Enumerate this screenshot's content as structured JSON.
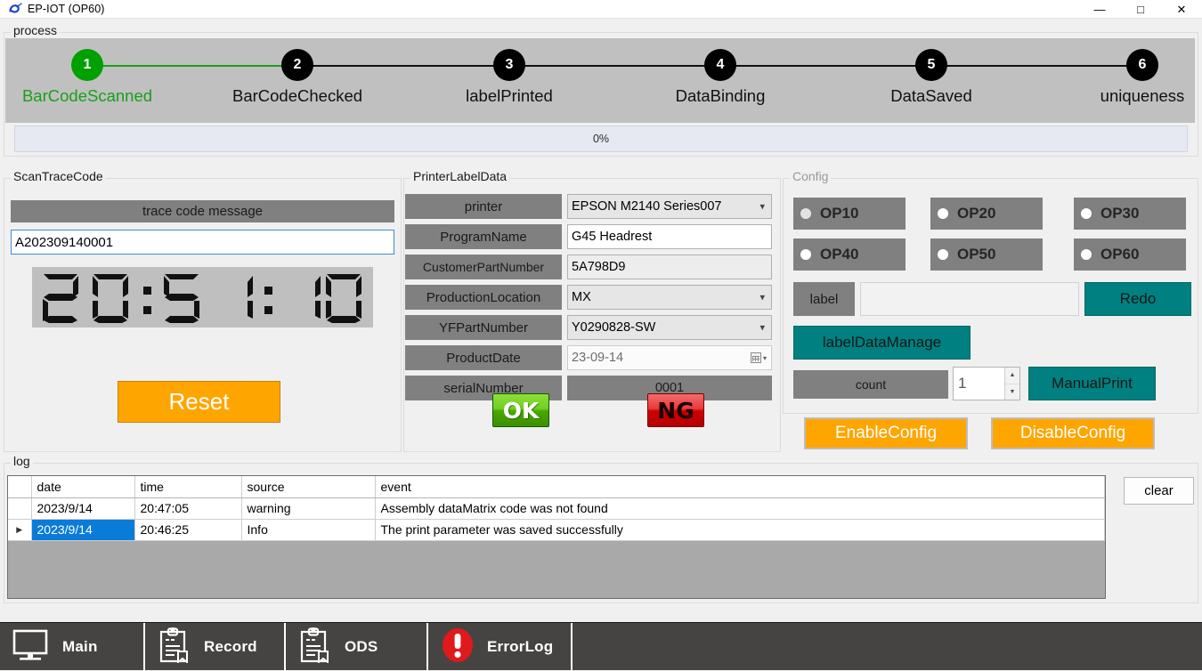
{
  "window": {
    "title": "EP-IOT (OP60)",
    "icon": "app-logo-icon",
    "minimize": "—",
    "maximize": "□",
    "close": "✕"
  },
  "process": {
    "legend": "process",
    "steps": [
      {
        "num": "1",
        "label": "BarCodeScanned",
        "state": "done"
      },
      {
        "num": "2",
        "label": "BarCodeChecked",
        "state": "pending"
      },
      {
        "num": "3",
        "label": "labelPrinted",
        "state": "pending"
      },
      {
        "num": "4",
        "label": "DataBinding",
        "state": "pending"
      },
      {
        "num": "5",
        "label": "DataSaved",
        "state": "pending"
      },
      {
        "num": "6",
        "label": "uniqueness",
        "state": "pending"
      }
    ],
    "progress_text": "0%",
    "progress_value": 0,
    "done_color": "#19a019",
    "pending_color": "#000000"
  },
  "scan": {
    "legend": "ScanTraceCode",
    "header_label": "trace code message",
    "input_value": "A202309140001",
    "input_placeholder": "",
    "clock": "20:51:10",
    "reset_label": "Reset",
    "reset_color": "#ffa500"
  },
  "printer": {
    "legend": "PrinterLabelData",
    "rows": [
      {
        "label": "printer",
        "value": "EPSON M2140 Series007",
        "kind": "combo"
      },
      {
        "label": "ProgramName",
        "value": "G45 Headrest",
        "kind": "text"
      },
      {
        "label": "CustomerPartNumber",
        "value": "5A798D9",
        "kind": "textgray"
      },
      {
        "label": "ProductionLocation",
        "value": "MX",
        "kind": "combo"
      },
      {
        "label": "YFPartNumber",
        "value": "Y0290828-SW",
        "kind": "combo"
      },
      {
        "label": "ProductDate",
        "value": "23-09-14",
        "kind": "date"
      },
      {
        "label": "serialNumber",
        "value": "0001",
        "kind": "gray"
      }
    ],
    "ok_label": "OK",
    "ng_label": "NG"
  },
  "config": {
    "legend": "Config",
    "stations": [
      {
        "label": "OP10",
        "selected": true
      },
      {
        "label": "OP20",
        "selected": false
      },
      {
        "label": "OP30",
        "selected": false
      },
      {
        "label": "OP40",
        "selected": false
      },
      {
        "label": "OP50",
        "selected": false
      },
      {
        "label": "OP60",
        "selected": false
      }
    ],
    "label_btn": "label",
    "label_value": "",
    "redo_label": "Redo",
    "label_data_manage": "labelDataManage",
    "count_label": "count",
    "count_value": "1",
    "manual_print": "ManualPrint",
    "enable_config": "EnableConfig",
    "disable_config": "DisableConfig",
    "teal_color": "#008080",
    "orange_color": "#ffa500"
  },
  "log": {
    "legend": "log",
    "columns": [
      "",
      "date",
      "time",
      "source",
      "event"
    ],
    "rows": [
      {
        "mark": "",
        "date": "2023/9/14",
        "time": "20:47:05",
        "source": "warning",
        "event": "Assembly dataMatrix code was not found",
        "selected": false
      },
      {
        "mark": "▶",
        "date": "2023/9/14",
        "time": "20:46:25",
        "source": "Info",
        "event": "The print parameter was saved successfully",
        "selected": true
      }
    ],
    "clear_label": "clear",
    "selection_color": "#0a7bd8"
  },
  "bottombar": {
    "items": [
      {
        "label": "Main",
        "icon": "monitor-icon"
      },
      {
        "label": "Record",
        "icon": "clipboard-icon"
      },
      {
        "label": "ODS",
        "icon": "clipboard-icon"
      },
      {
        "label": "ErrorLog",
        "icon": "error-exclamation-icon"
      }
    ]
  }
}
